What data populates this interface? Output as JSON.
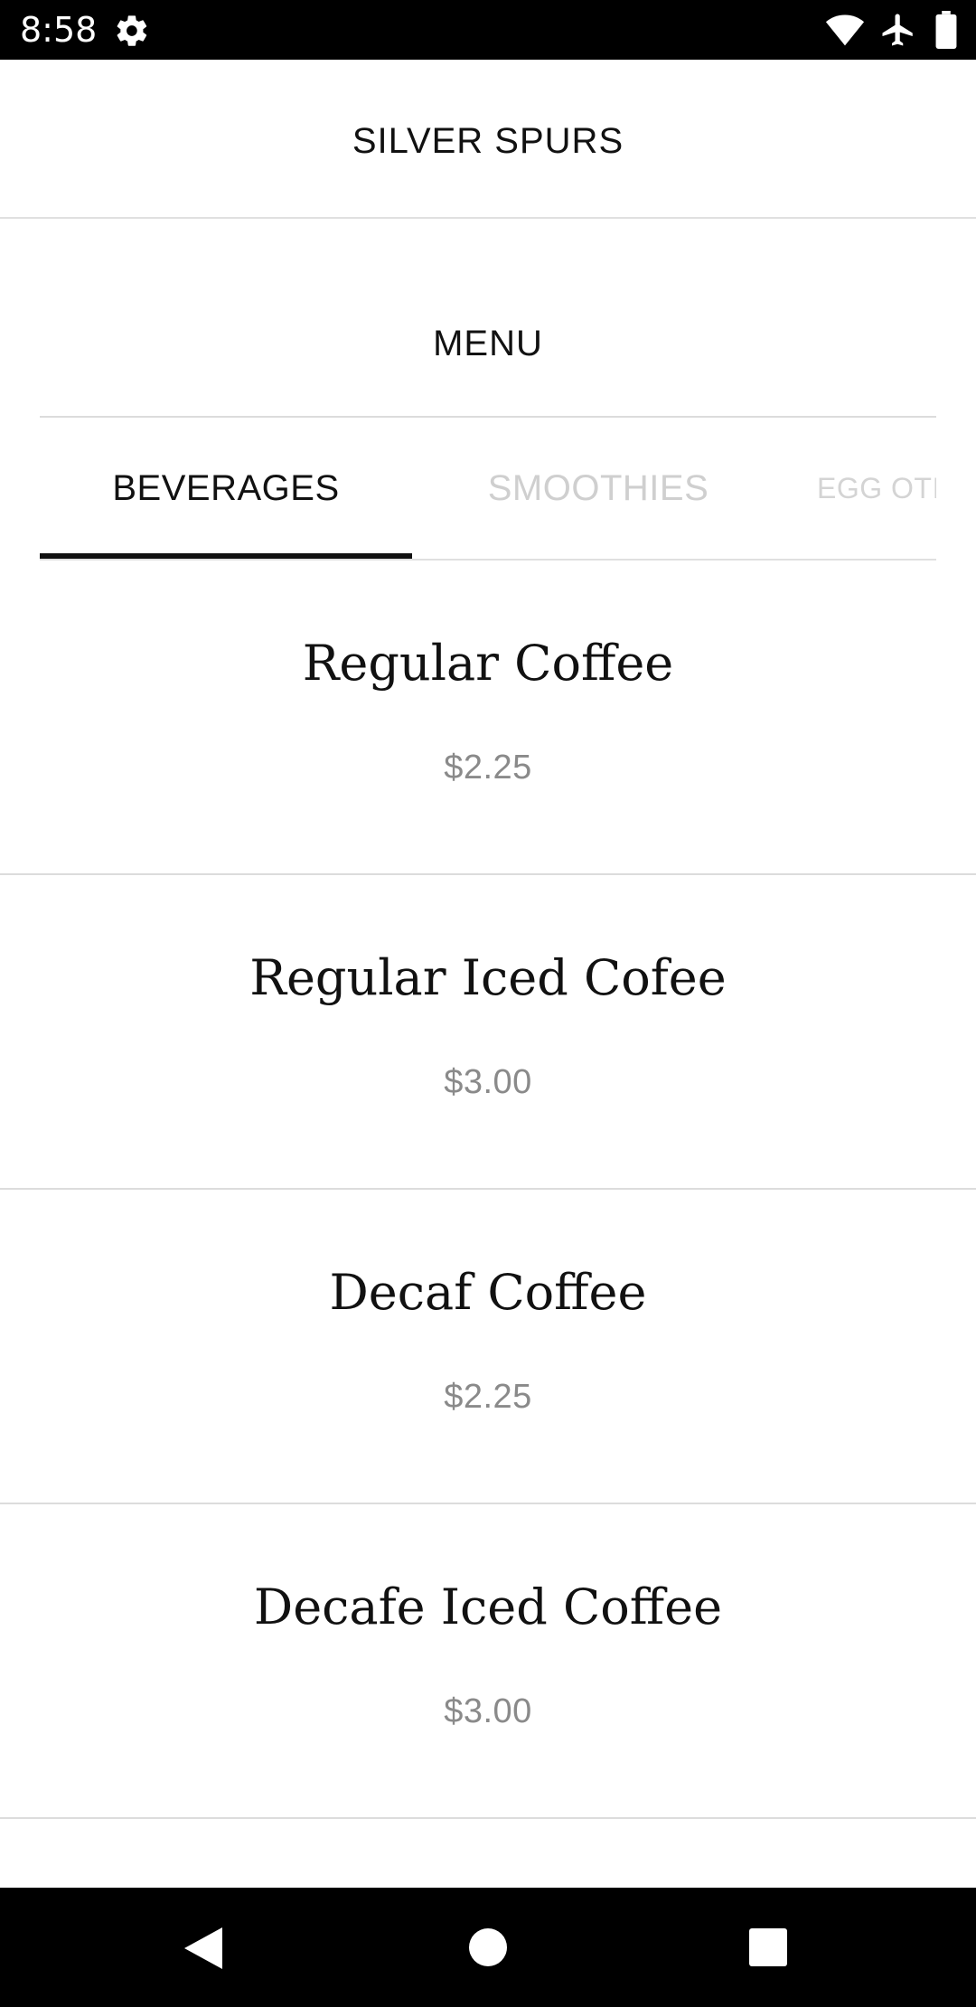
{
  "status_bar": {
    "time": "8:58",
    "icons": [
      "gear-icon",
      "wifi-icon",
      "airplane-icon",
      "battery-icon"
    ]
  },
  "header": {
    "title": "SILVER SPURS"
  },
  "menu": {
    "title": "MENU",
    "tabs": [
      {
        "label": "BEVERAGES",
        "selected": true
      },
      {
        "label": "SMOOTHIES",
        "selected": false
      },
      {
        "label": "EGG OTIS",
        "selected": false
      }
    ],
    "items": [
      {
        "name": "Regular Coffee",
        "price": "$2.25"
      },
      {
        "name": "Regular Iced Cofee",
        "price": "$3.00"
      },
      {
        "name": "Decaf Coffee",
        "price": "$2.25"
      },
      {
        "name": "Decafe Iced Coffee",
        "price": "$3.00"
      }
    ]
  },
  "nav_bar": {
    "icons": [
      "back-icon",
      "home-icon",
      "recents-icon"
    ]
  },
  "colors": {
    "text": "#111111",
    "price": "#8a8a8a",
    "inactive_tab": "#cfcfcf",
    "divider": "#dcdcdc"
  }
}
